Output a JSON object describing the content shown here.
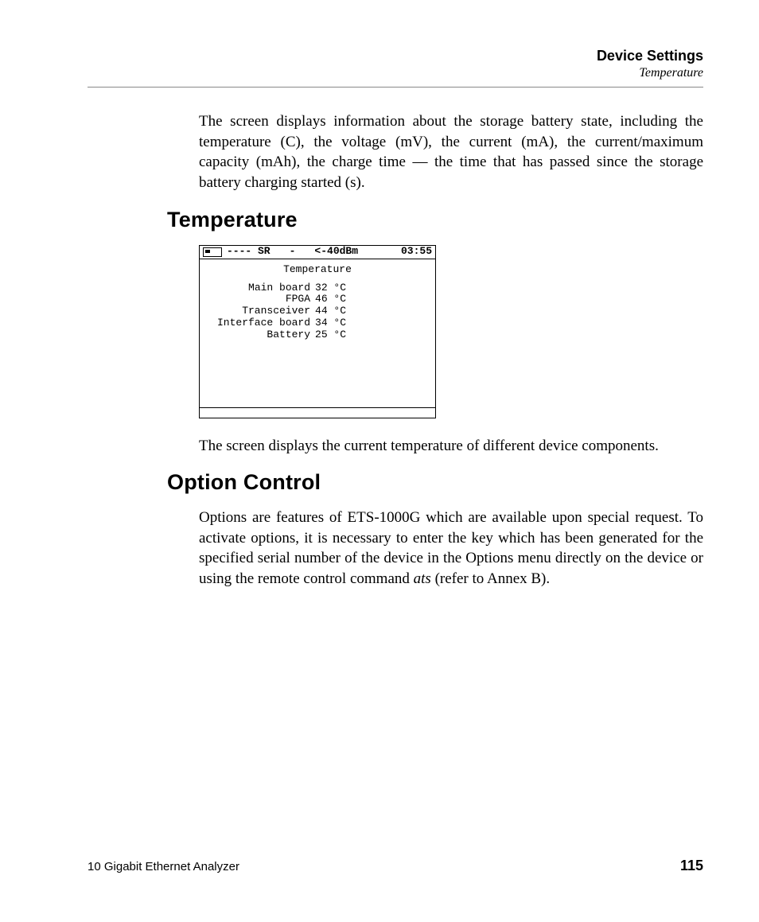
{
  "header": {
    "section": "Device Settings",
    "subsection": "Temperature"
  },
  "intro_para": "The screen displays information about the storage battery state, including the temperature (C), the voltage (mV), the current (mA), the current/maximum capacity (mAh), the charge time — the time that has passed since the storage battery charging started (s).",
  "sections": {
    "temperature": {
      "heading": "Temperature",
      "after_text": "The screen displays the current temperature of different device components."
    },
    "option_control": {
      "heading": "Option Control",
      "para_pre": "Options are features of ETS-1000G which are available upon special request. To activate options, it is necessary to enter the key which has been generated for the specified serial number of the device in the Options menu directly on the device or using the remote control command ",
      "command": "ats",
      "para_post": " (refer to Annex B)."
    }
  },
  "screenshot": {
    "statusbar": {
      "left": "---- SR",
      "mid": "-",
      "signal": "<-40dBm",
      "time": "03:55"
    },
    "title": "Temperature",
    "rows": [
      {
        "label": "Main board",
        "value": "32 °C"
      },
      {
        "label": "FPGA",
        "value": "46 °C"
      },
      {
        "label": "Transceiver",
        "value": "44 °C"
      },
      {
        "label": "Interface board",
        "value": "34 °C"
      },
      {
        "label": "Battery",
        "value": "25 °C"
      }
    ]
  },
  "footer": {
    "product": "10 Gigabit Ethernet Analyzer",
    "page": "115"
  }
}
